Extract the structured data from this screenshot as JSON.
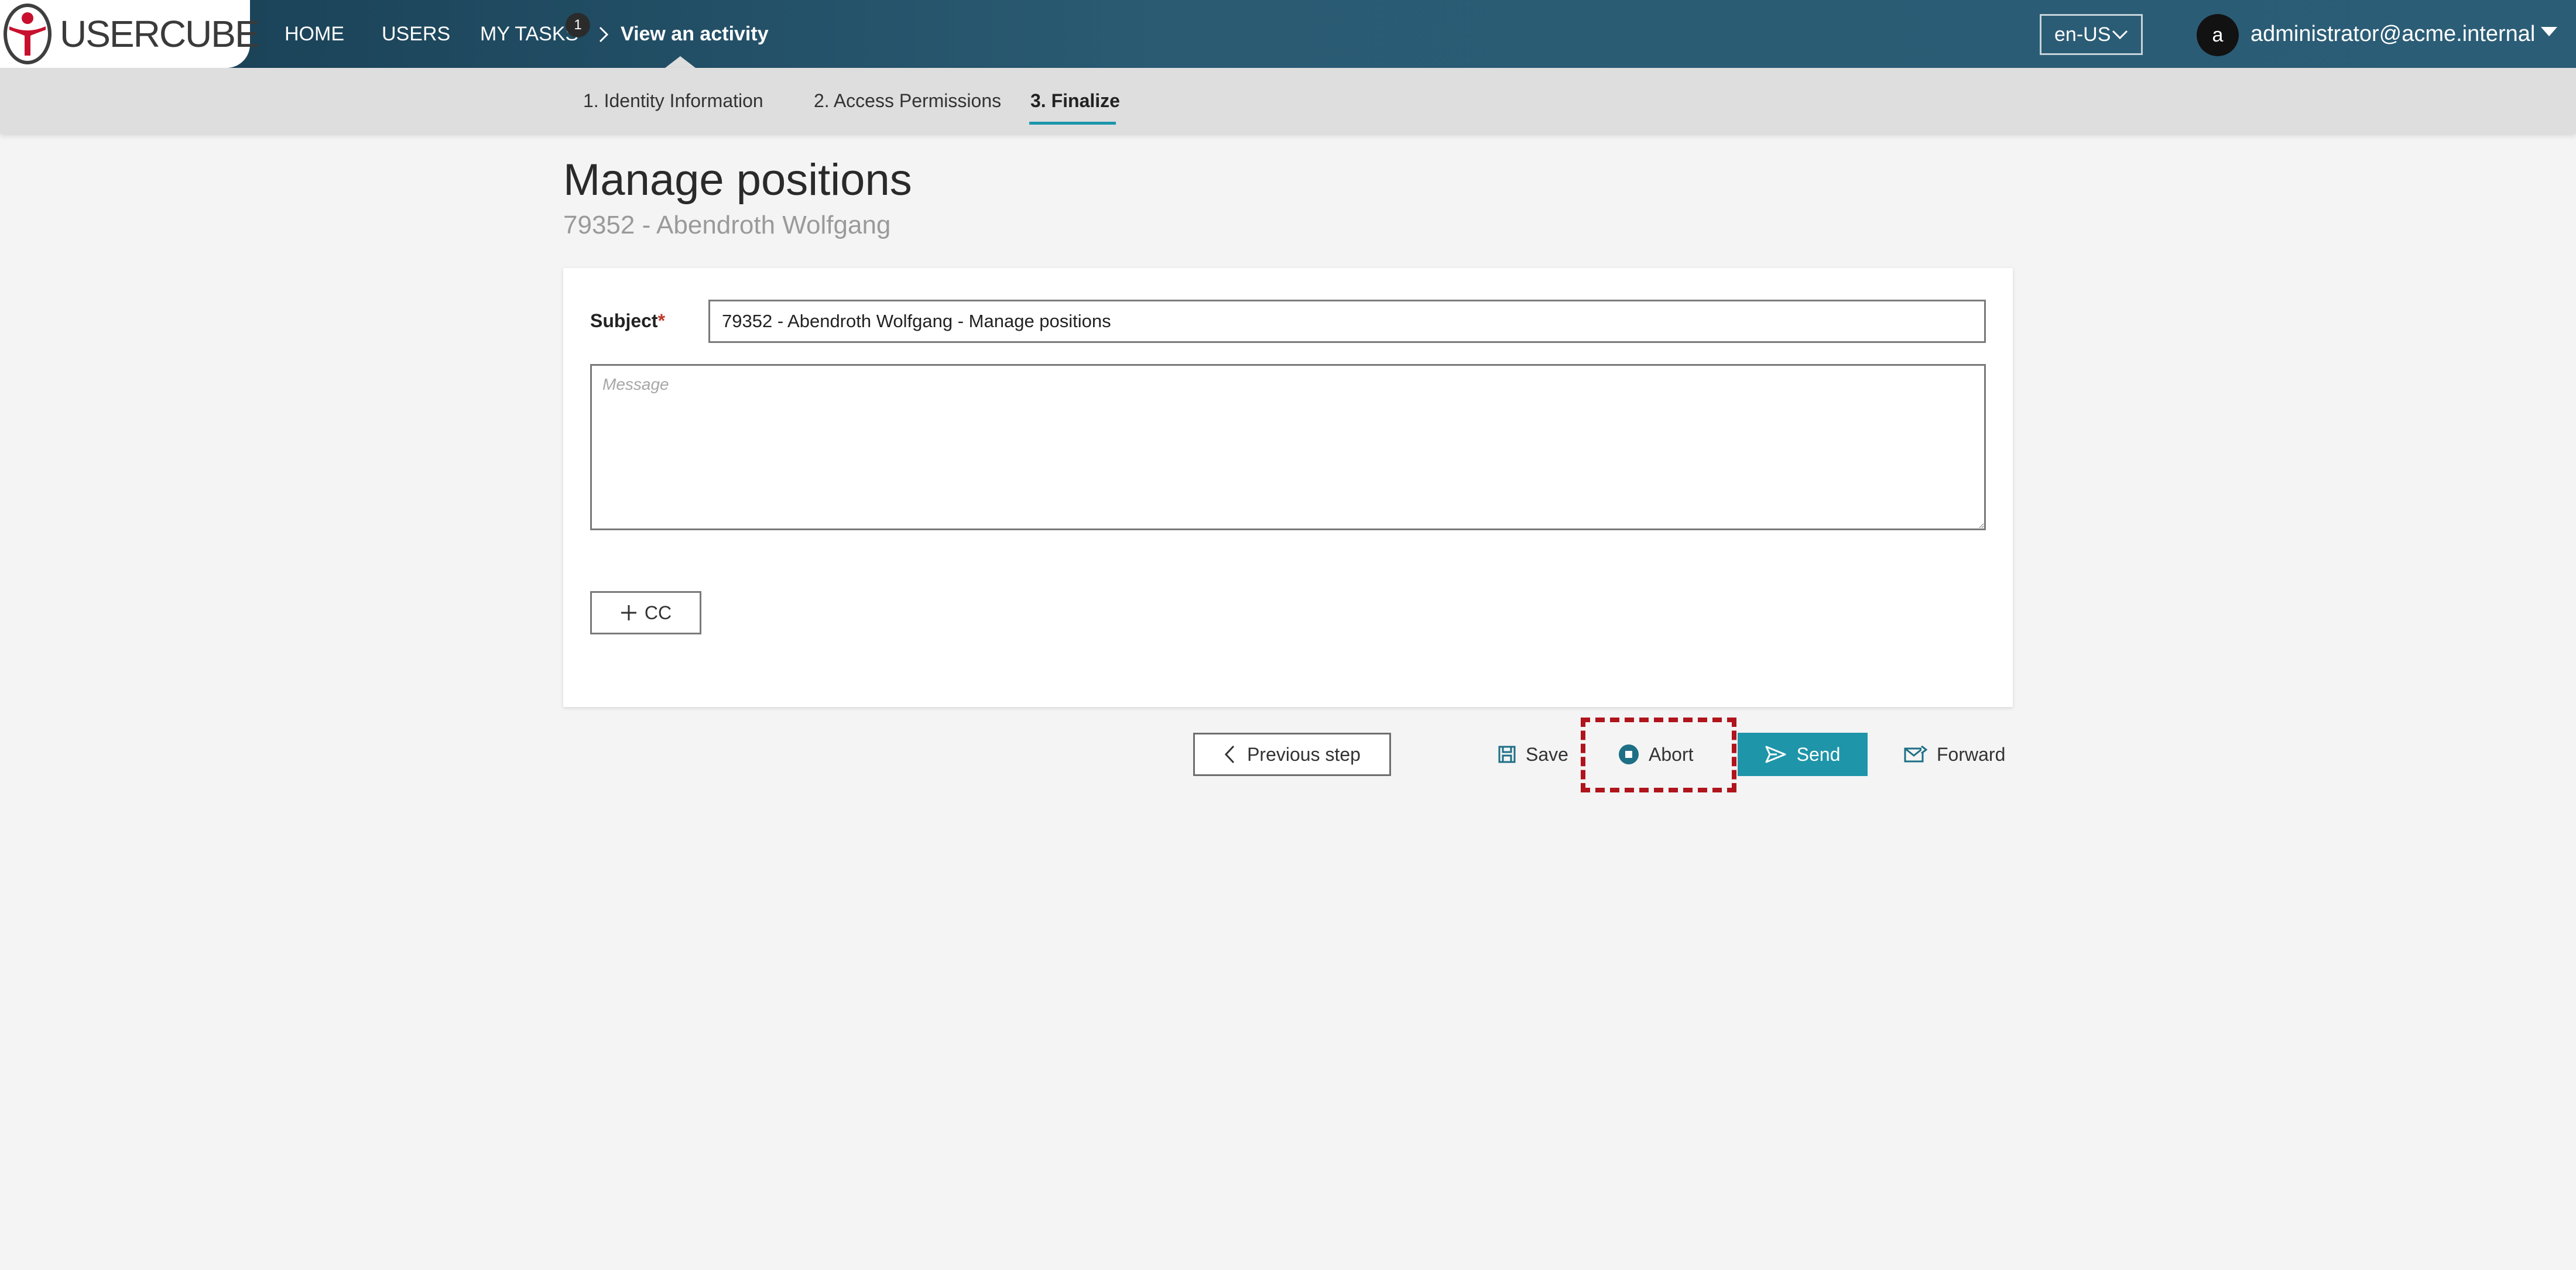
{
  "app": {
    "logo_text": "USERCUBE"
  },
  "nav": {
    "home": "HOME",
    "users": "USERS",
    "my_tasks": "MY TASKS",
    "my_tasks_badge": "1",
    "current": "View an activity",
    "language": "en-US",
    "avatar_letter": "a",
    "user": "administrator@acme.internal"
  },
  "steps": [
    {
      "label": "1. Identity Information"
    },
    {
      "label": "2. Access Permissions"
    },
    {
      "label": "3. Finalize",
      "active": true
    }
  ],
  "page": {
    "title": "Manage positions",
    "subtitle": "79352 - Abendroth Wolfgang"
  },
  "form": {
    "subject_label": "Subject",
    "required_mark": "*",
    "subject_value": "79352 - Abendroth Wolfgang - Manage positions",
    "message_placeholder": "Message",
    "cc_label": "CC"
  },
  "actions": {
    "previous": "Previous step",
    "save": "Save",
    "abort": "Abort",
    "send": "Send",
    "forward": "Forward"
  },
  "colors": {
    "accent": "#1e95a8",
    "topbar": "#2a5b73",
    "highlight": "#b0141c"
  },
  "icons": [
    "usercube-logo-icon",
    "chevron-right-icon",
    "chevron-down-icon",
    "caret-down-icon",
    "plus-icon",
    "chevron-left-icon",
    "save-icon",
    "stop-icon",
    "send-icon",
    "forward-icon"
  ]
}
